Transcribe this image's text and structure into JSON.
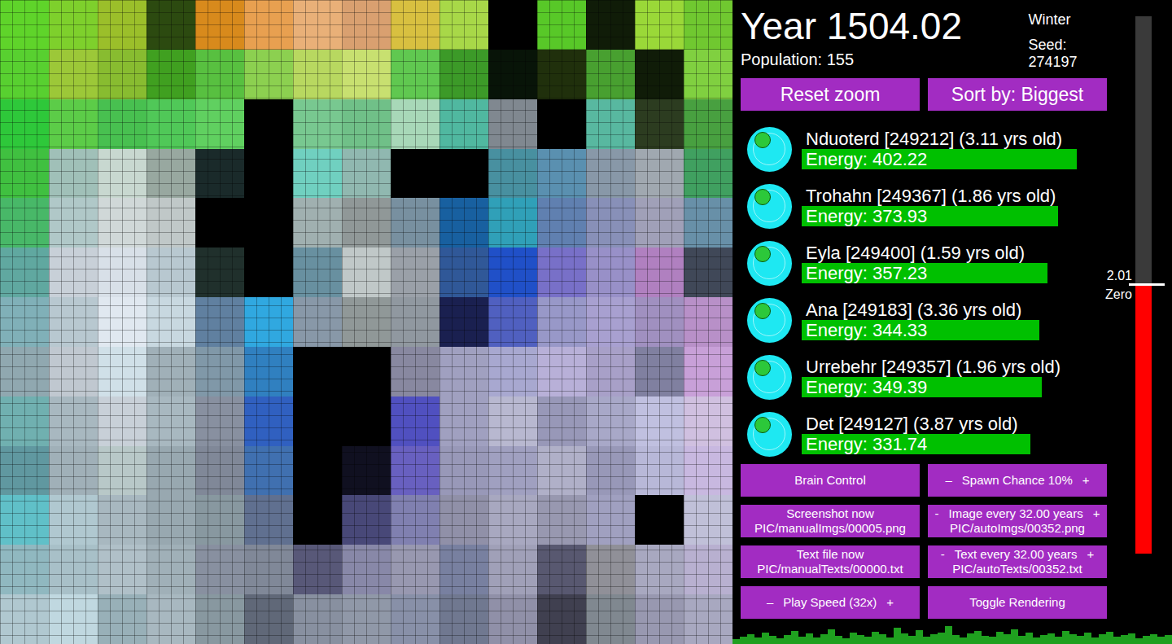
{
  "header": {
    "year": "Year 1504.02",
    "population": "Population: 155",
    "season": "Winter",
    "seed": "Seed: 274197"
  },
  "top_buttons": [
    "Reset zoom",
    "Sort by: Biggest"
  ],
  "creatures": [
    {
      "name": "Nduoterd [249212] (3.11 yrs old)",
      "energy": "Energy: 402.22",
      "level": 0.94
    },
    {
      "name": "Trohahn [249367] (1.86 yrs old)",
      "energy": "Energy: 373.93",
      "level": 0.875
    },
    {
      "name": "Eyla [249400] (1.59 yrs old)",
      "energy": "Energy: 357.23",
      "level": 0.84
    },
    {
      "name": "Ana [249183] (3.36 yrs old)",
      "energy": "Energy: 344.33",
      "level": 0.81
    },
    {
      "name": "Urrebehr [249357] (1.96 yrs old)",
      "energy": "Energy: 349.39",
      "level": 0.82
    },
    {
      "name": "Det [249127] (3.87 yrs old)",
      "energy": "Energy: 331.74",
      "level": 0.78
    }
  ],
  "slider": {
    "level": 0.5,
    "labels": [
      "2.01",
      "Zero"
    ]
  },
  "controls": [
    {
      "kind": "button",
      "label": "Brain Control"
    },
    {
      "kind": "stepper",
      "minus": "–",
      "label": "Spawn Chance 10%",
      "plus": "+"
    },
    {
      "kind": "button",
      "label": "Screenshot now",
      "sub": "PIC/manualImgs/00005.png"
    },
    {
      "kind": "stepper",
      "minus": "-",
      "label": "Image every 32.00 years",
      "plus": "+",
      "sub": "PIC/autoImgs/00352.png"
    },
    {
      "kind": "button",
      "label": "Text file now",
      "sub": "PIC/manualTexts/00000.txt"
    },
    {
      "kind": "stepper",
      "minus": "-",
      "label": "Text every 32.00 years",
      "plus": "+",
      "sub": "PIC/autoTexts/00352.txt"
    },
    {
      "kind": "stepper",
      "minus": "–",
      "label": "Play Speed (32x)",
      "plus": "+"
    },
    {
      "kind": "button",
      "label": "Toggle Rendering"
    }
  ],
  "population_graph": {
    "values": [
      6,
      9,
      12,
      8,
      14,
      10,
      7,
      11,
      16,
      9,
      13,
      8,
      12,
      18,
      10,
      7,
      14,
      11,
      9,
      15,
      12,
      8,
      20,
      13,
      10,
      17,
      9,
      12,
      14,
      22,
      11,
      8,
      13,
      16,
      10,
      9,
      15,
      12,
      18,
      10,
      14,
      8,
      11,
      13,
      9,
      16,
      12,
      10,
      14,
      8,
      12,
      15,
      9,
      11,
      13,
      7,
      10,
      12,
      9,
      11
    ]
  },
  "map": {
    "rows": [
      [
        "#5fd42a",
        "#7ed02c",
        "#9bbf2a",
        "#2c4a10",
        "#d88a1c",
        "#e8a050",
        "#e9b078",
        "#d9a070",
        "#d8c040",
        "#a8d848",
        "#000000",
        "#58c828",
        "#101c08",
        "#9ad838",
        "#70c830"
      ],
      [
        "#58d030",
        "#9cc838",
        "#88bc30",
        "#40a020",
        "#58c040",
        "#8cd050",
        "#b8d860",
        "#c8e070",
        "#60c850",
        "#3c9a28",
        "#081408",
        "#20300c",
        "#48a030",
        "#101c08",
        "#80d040"
      ],
      [
        "#2ec83a",
        "#5ccc48",
        "#48c050",
        "#50c858",
        "#60d060",
        "#000000",
        "#78c890",
        "#70c088",
        "#a8d8b8",
        "#50b8a0",
        "#808890",
        "#000000",
        "#58b8a0",
        "#2c3c20",
        "#48a040"
      ],
      [
        "#40c040",
        "#a0c0b8",
        "#c8d8d0",
        "#98a8a0",
        "#1a2a2a",
        "#000000",
        "#70d0c0",
        "#90b8b0",
        "#000000",
        "#000000",
        "#4890a0",
        "#5a90b0",
        "#8898a8",
        "#a0a8b0",
        "#40a060"
      ],
      [
        "#48b868",
        "#b0c8c8",
        "#d0d8d8",
        "#c0c8c8",
        "#000000",
        "#000000",
        "#a0b0b0",
        "#909898",
        "#7890a0",
        "#1860a0",
        "#30a0b8",
        "#6080b0",
        "#8890b8",
        "#a0a0b8",
        "#6890a8"
      ],
      [
        "#60a8a0",
        "#c8d0d8",
        "#d8e0e8",
        "#b8c8d0",
        "#20302c",
        "#000000",
        "#6890a0",
        "#c0c8c8",
        "#9aa0a8",
        "#305898",
        "#2050c8",
        "#7870c8",
        "#9890c8",
        "#b080c0",
        "#404858"
      ],
      [
        "#80b0b8",
        "#b8c8d0",
        "#e0e8f0",
        "#c8d8e0",
        "#6080a0",
        "#30a8e0",
        "#8898a8",
        "#909898",
        "#9098a0",
        "#1a2050",
        "#5060c0",
        "#9898c8",
        "#a8a0d0",
        "#a090c0",
        "#b890c8"
      ],
      [
        "#90a8b0",
        "#c0c8d0",
        "#d0e0e8",
        "#a0b0b8",
        "#8098a8",
        "#3080c0",
        "#000000",
        "#000000",
        "#8888a0",
        "#a0a0c0",
        "#a8a8d0",
        "#b8b0d8",
        "#a8a0c8",
        "#8080a0",
        "#c8a0d8"
      ],
      [
        "#70b0b0",
        "#a8b8c0",
        "#c8d0d8",
        "#a8b8c0",
        "#8890a0",
        "#3060c0",
        "#000000",
        "#000000",
        "#5050c0",
        "#a0a0c0",
        "#b8b8d0",
        "#9898b8",
        "#a8a8c8",
        "#c0c0e0",
        "#d0c0e0"
      ],
      [
        "#6098a0",
        "#a0b0b8",
        "#b8c8c8",
        "#98a8b0",
        "#808898",
        "#4070b0",
        "#000000",
        "#101020",
        "#6860c0",
        "#9898b8",
        "#a0a0c0",
        "#b0b0c8",
        "#9898b8",
        "#b8b8d8",
        "#c8b8e0"
      ],
      [
        "#60c0c8",
        "#b0c8d0",
        "#a8b8c0",
        "#98a8b0",
        "#8898a0",
        "#607090",
        "#000000",
        "#484878",
        "#8080b0",
        "#9090a8",
        "#a8a8c0",
        "#9898b0",
        "#a0a0c0",
        "#000000",
        "#c0c0d8"
      ],
      [
        "#90b8c0",
        "#a8c0c8",
        "#b0c0c8",
        "#a0b0b8",
        "#8890a0",
        "#808898",
        "#585878",
        "#8888a8",
        "#9898b0",
        "#7880a0",
        "#a0a0b8",
        "#585870",
        "#909098",
        "#a8a8c0",
        "#b8b0d0"
      ],
      [
        "#b0c8d0",
        "#c0d8e0",
        "#98b0b8",
        "#a8b8c0",
        "#8898a0",
        "#606878",
        "#8890a0",
        "#9098a8",
        "#8890a8",
        "#707890",
        "#9090a8",
        "#404050",
        "#808890",
        "#9898b0",
        "#a8a8c0"
      ]
    ]
  }
}
